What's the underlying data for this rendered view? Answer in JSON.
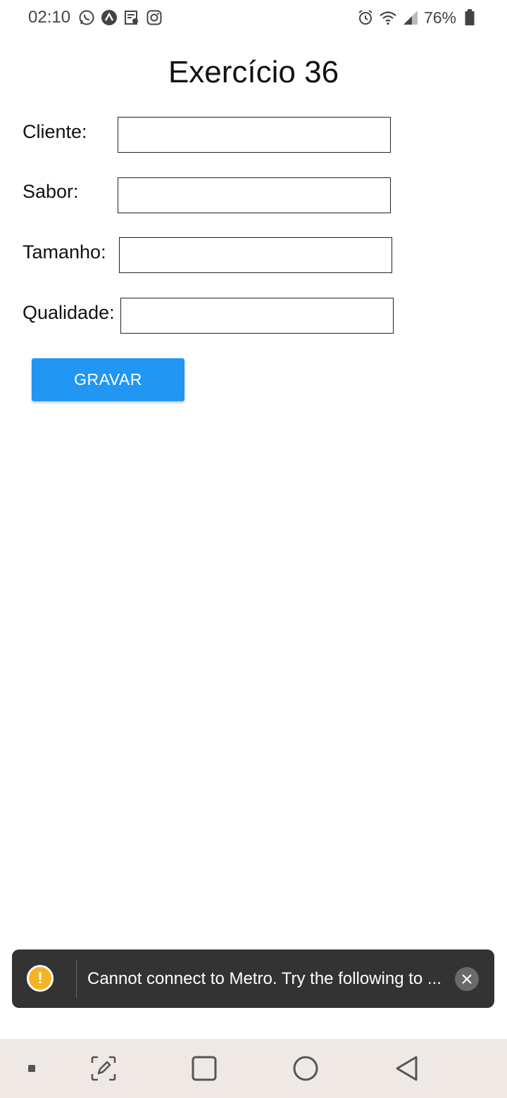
{
  "status_bar": {
    "time": "02:10",
    "battery": "76%",
    "left_icons": [
      "whatsapp-icon",
      "expo-icon",
      "receipt-icon",
      "instagram-icon"
    ],
    "right_icons": [
      "alarm-icon",
      "wifi-icon",
      "signal-icon",
      "battery-icon"
    ]
  },
  "page": {
    "title": "Exercício 36"
  },
  "form": {
    "cliente_label": "Cliente:",
    "cliente_value": "",
    "sabor_label": "Sabor:",
    "sabor_value": "",
    "tamanho_label": "Tamanho:",
    "tamanho_value": "",
    "qualidade_label": "Qualidade:",
    "qualidade_value": "",
    "submit_label": "GRAVAR"
  },
  "toast": {
    "message": "Cannot connect to Metro.  Try the following to ...",
    "icon": "warning-icon",
    "close_icon": "close-icon"
  },
  "nav_bar": {
    "items": [
      "recent-apps-indicator",
      "screenshot-edit-icon",
      "recents-square-icon",
      "home-circle-icon",
      "back-triangle-icon"
    ]
  },
  "colors": {
    "button": "#2196F3",
    "toast_bg": "#333333",
    "warning": "#f5b324",
    "nav_bg": "#efe9e6"
  }
}
